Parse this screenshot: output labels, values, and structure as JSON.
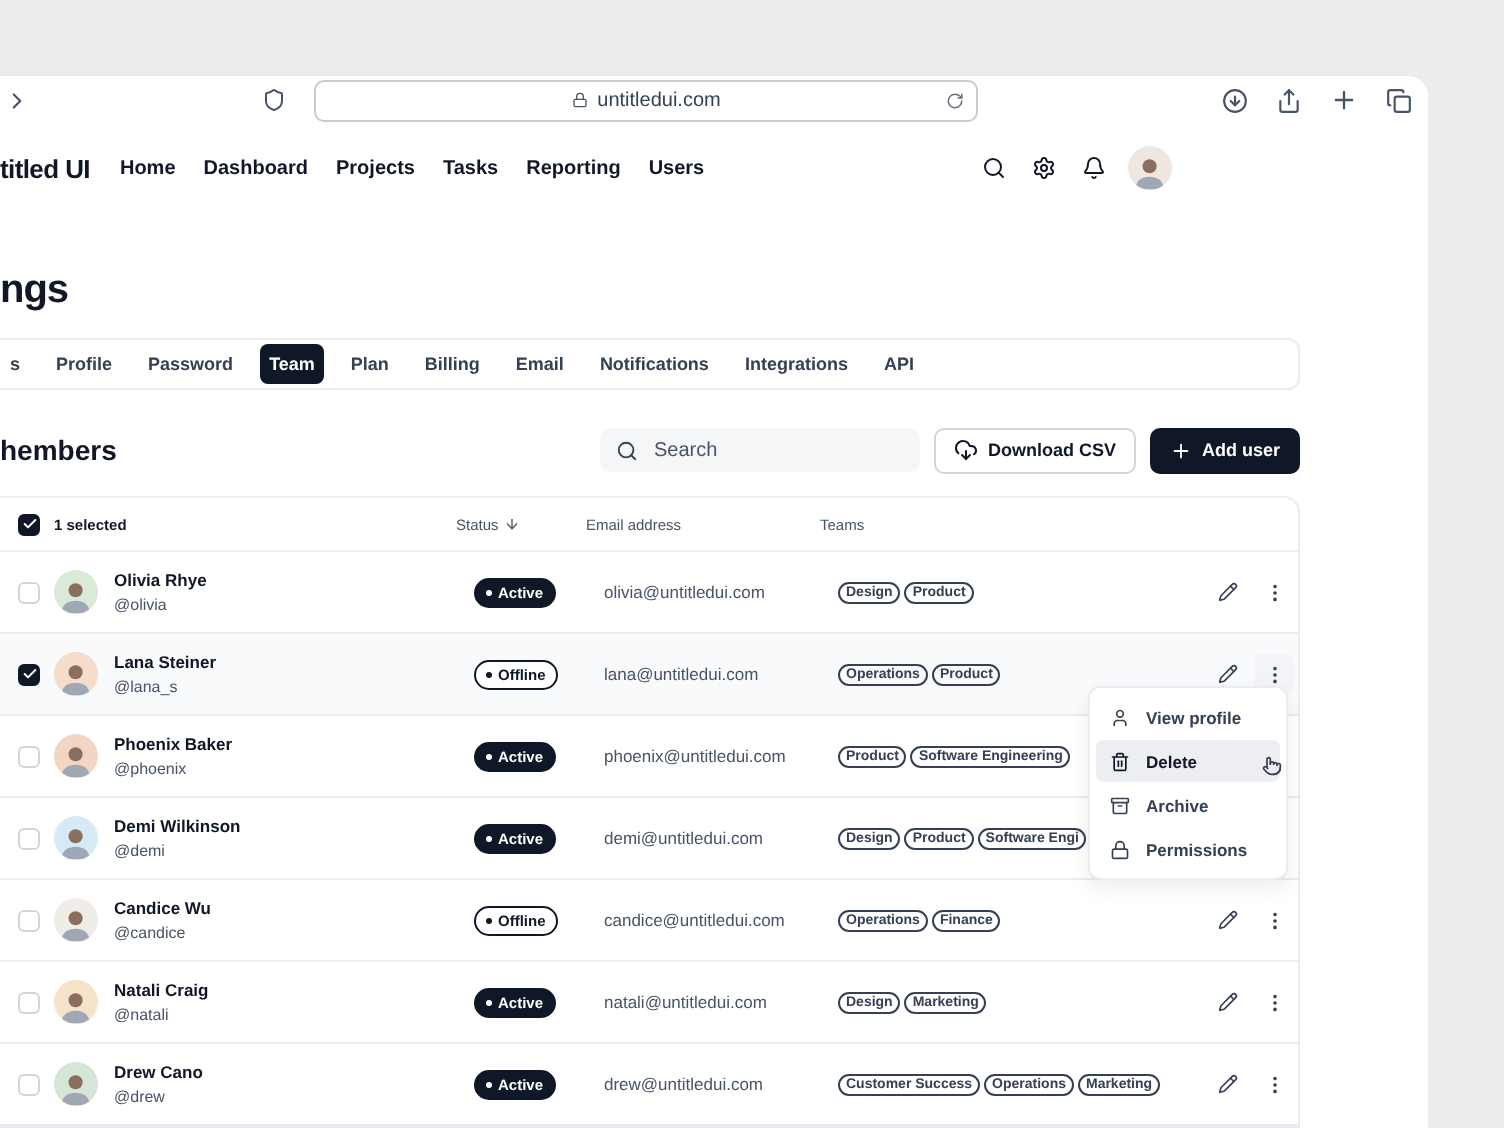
{
  "browser": {
    "url": "untitledui.com"
  },
  "app": {
    "brand": "titled UI",
    "nav": [
      "Home",
      "Dashboard",
      "Projects",
      "Tasks",
      "Reporting",
      "Users"
    ]
  },
  "page_title": "ngs",
  "tabs": [
    {
      "label": "s",
      "selected": false
    },
    {
      "label": "Profile",
      "selected": false
    },
    {
      "label": "Password",
      "selected": false
    },
    {
      "label": "Team",
      "selected": true
    },
    {
      "label": "Plan",
      "selected": false
    },
    {
      "label": "Billing",
      "selected": false
    },
    {
      "label": "Email",
      "selected": false
    },
    {
      "label": "Notifications",
      "selected": false
    },
    {
      "label": "Integrations",
      "selected": false
    },
    {
      "label": "API",
      "selected": false
    }
  ],
  "section_title": "hembers",
  "search": {
    "placeholder": "Search"
  },
  "buttons": {
    "download": "Download CSV",
    "add": "Add user"
  },
  "table": {
    "header": {
      "label": "1 selected",
      "checked": true
    },
    "columns": [
      "Status",
      "Email address",
      "Teams"
    ],
    "rows": [
      {
        "name": "Olivia Rhye",
        "handle": "@olivia",
        "status": "Active",
        "filled": true,
        "email": "olivia@untitledui.com",
        "teams": [
          "Design",
          "Product"
        ],
        "checked": false
      },
      {
        "name": "Lana Steiner",
        "handle": "@lana_s",
        "status": "Offline",
        "filled": false,
        "email": "lana@untitledui.com",
        "teams": [
          "Operations",
          "Product"
        ],
        "checked": true
      },
      {
        "name": "Phoenix Baker",
        "handle": "@phoenix",
        "status": "Active",
        "filled": true,
        "email": "phoenix@untitledui.com",
        "teams": [
          "Product",
          "Software Engineering"
        ],
        "checked": false
      },
      {
        "name": "Demi Wilkinson",
        "handle": "@demi",
        "status": "Active",
        "filled": true,
        "email": "demi@untitledui.com",
        "teams": [
          "Design",
          "Product",
          "Software Engi"
        ],
        "checked": false
      },
      {
        "name": "Candice Wu",
        "handle": "@candice",
        "status": "Offline",
        "filled": false,
        "email": "candice@untitledui.com",
        "teams": [
          "Operations",
          "Finance"
        ],
        "checked": false
      },
      {
        "name": "Natali Craig",
        "handle": "@natali",
        "status": "Active",
        "filled": true,
        "email": "natali@untitledui.com",
        "teams": [
          "Design",
          "Marketing"
        ],
        "checked": false
      },
      {
        "name": "Drew Cano",
        "handle": "@drew",
        "status": "Active",
        "filled": true,
        "email": "drew@untitledui.com",
        "teams": [
          "Customer Success",
          "Operations",
          "Marketing"
        ],
        "checked": false
      }
    ]
  },
  "menu": {
    "items": [
      {
        "label": "View profile",
        "kind": "user",
        "selected": false
      },
      {
        "label": "Delete",
        "kind": "trash",
        "selected": true
      },
      {
        "label": "Archive",
        "kind": "archive",
        "selected": false
      },
      {
        "label": "Permissions",
        "kind": "lock",
        "selected": false
      }
    ]
  }
}
